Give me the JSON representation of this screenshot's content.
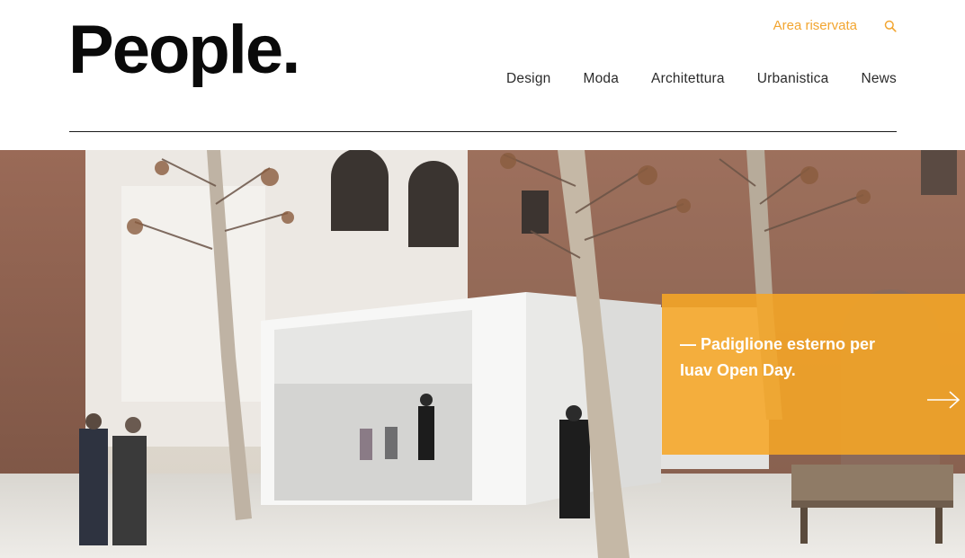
{
  "header": {
    "logo": "People.",
    "area_link": "Area riservata",
    "search_icon": "search-icon"
  },
  "nav": {
    "items": [
      "Design",
      "Moda",
      "Architettura",
      "Urbanistica",
      "News"
    ]
  },
  "hero": {
    "caption": "— Padiglione esterno per Iuav Open Day.",
    "arrow_icon": "arrow-right-icon"
  },
  "colors": {
    "accent": "#f2a530",
    "caption_bg": "#f6a626",
    "text": "#2b2b2b"
  }
}
